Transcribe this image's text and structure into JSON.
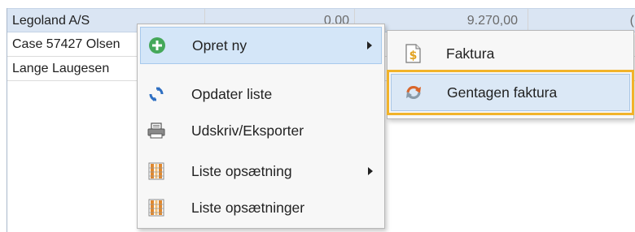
{
  "grid": {
    "rows": [
      {
        "name": "Legoland A/S",
        "col2": "0,00",
        "col3": "9.270,00",
        "col4": "("
      },
      {
        "name": "Case 57427 Olsen",
        "col2": "",
        "col3": "",
        "col4": ""
      },
      {
        "name": "Lange Laugesen",
        "col2": "",
        "col3": "",
        "col4": ""
      }
    ]
  },
  "context_menu": {
    "items": [
      {
        "label": "Opret ny",
        "icon": "add-circle-icon",
        "has_submenu": true,
        "active": true
      },
      {
        "label": "Opdater liste",
        "icon": "refresh-icon",
        "has_submenu": false
      },
      {
        "label": "Udskriv/Eksporter",
        "icon": "printer-icon",
        "has_submenu": false
      },
      {
        "label": "Liste opsætning",
        "icon": "columns-icon",
        "has_submenu": true
      },
      {
        "label": "Liste opsætninger",
        "icon": "columns-icon",
        "has_submenu": false
      }
    ]
  },
  "submenu": {
    "items": [
      {
        "label": "Faktura",
        "icon": "invoice-icon"
      },
      {
        "label": "Gentagen faktura",
        "icon": "recurring-icon",
        "active": true
      }
    ]
  },
  "colors": {
    "selected_row": "#dae5f3",
    "menu_hover": "#d4e6f8",
    "highlight_outline": "#f1b32a",
    "add_icon_green": "#45a85a",
    "refresh_icon_blue": "#2e6fc2",
    "recurring_icon_orange": "#d9662b"
  }
}
